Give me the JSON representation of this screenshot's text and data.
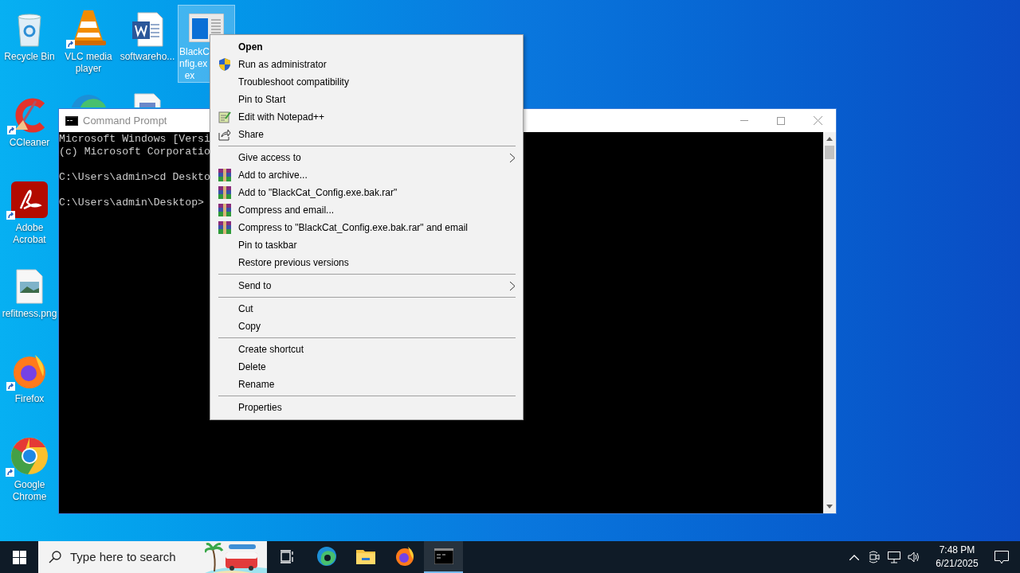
{
  "desktop_icon_columns": [
    [
      {
        "kind": "recycle-bin",
        "label": "Recycle Bin",
        "shortcut": false,
        "selected": false
      },
      {
        "kind": "ccleaner",
        "label": "CCleaner",
        "shortcut": true,
        "selected": false
      },
      {
        "kind": "pdf-app",
        "label": "Adobe\nAcrobat",
        "shortcut": true,
        "selected": false
      },
      {
        "kind": "image-file",
        "label": "refitness.png",
        "shortcut": false,
        "selected": false
      },
      {
        "kind": "firefox",
        "label": "Firefox",
        "shortcut": true,
        "selected": false
      },
      {
        "kind": "chrome",
        "label": "Google\nChrome",
        "shortcut": true,
        "selected": false
      }
    ],
    [
      {
        "kind": "vlc",
        "label": "VLC media\nplayer",
        "shortcut": true,
        "selected": false
      },
      {
        "kind": "edge",
        "shortcut": false,
        "selected": false
      }
    ],
    [
      {
        "kind": "word-doc",
        "label": "softwareho...",
        "shortcut": false,
        "selected": false
      },
      {
        "kind": "doc-file",
        "shortcut": false,
        "selected": false
      }
    ],
    [
      {
        "kind": "exe-window",
        "label": "BlackC\nnfig.ex\n  ex",
        "shortcut": false,
        "selected": true
      }
    ]
  ],
  "console_window": {
    "title": "Command Prompt",
    "paragraphs": [
      [
        "Microsoft Windows [Versi",
        "(c) Microsoft Corporatio"
      ],
      [
        "C:\\Users\\admin>cd Deskto"
      ],
      [
        "C:\\Users\\admin\\Desktop>"
      ]
    ]
  },
  "context_menu": [
    {
      "kind": "command",
      "label": "Open",
      "default": true,
      "submenu": false
    },
    {
      "kind": "elevated",
      "label": "Run as administrator",
      "default": false,
      "submenu": false
    },
    {
      "kind": "command",
      "label": "Troubleshoot compatibility",
      "default": false,
      "submenu": false
    },
    {
      "kind": "command",
      "label": "Pin to Start",
      "default": false,
      "submenu": false
    },
    {
      "kind": "notepad",
      "label": "Edit with Notepad++",
      "default": false,
      "submenu": false
    },
    {
      "kind": "share",
      "label": "Share",
      "default": false,
      "submenu": false
    },
    {
      "kind": "separator"
    },
    {
      "kind": "command",
      "label": "Give access to",
      "default": false,
      "submenu": true
    },
    {
      "kind": "archive",
      "label": "Add to archive...",
      "default": false,
      "submenu": false
    },
    {
      "kind": "archive",
      "label": "Add to \"BlackCat_Config.exe.bak.rar\"",
      "default": false,
      "submenu": false
    },
    {
      "kind": "archive",
      "label": "Compress and email...",
      "default": false,
      "submenu": false
    },
    {
      "kind": "archive",
      "label": "Compress to \"BlackCat_Config.exe.bak.rar\" and email",
      "default": false,
      "submenu": false
    },
    {
      "kind": "command",
      "label": "Pin to taskbar",
      "default": false,
      "submenu": false
    },
    {
      "kind": "command",
      "label": "Restore previous versions",
      "default": false,
      "submenu": false
    },
    {
      "kind": "separator"
    },
    {
      "kind": "command",
      "label": "Send to",
      "default": false,
      "submenu": true
    },
    {
      "kind": "separator"
    },
    {
      "kind": "command",
      "label": "Cut",
      "default": false,
      "submenu": false
    },
    {
      "kind": "command",
      "label": "Copy",
      "default": false,
      "submenu": false
    },
    {
      "kind": "separator"
    },
    {
      "kind": "command",
      "label": "Create shortcut",
      "default": false,
      "submenu": false
    },
    {
      "kind": "command",
      "label": "Delete",
      "default": false,
      "submenu": false
    },
    {
      "kind": "command",
      "label": "Rename",
      "default": false,
      "submenu": false
    },
    {
      "kind": "separator"
    },
    {
      "kind": "command",
      "label": "Properties",
      "default": false,
      "submenu": false
    }
  ],
  "taskbar": {
    "search": {
      "placeholder": "Type here to search"
    },
    "apps": [
      {
        "kind": "task-view",
        "active": false
      },
      {
        "kind": "edge",
        "active": false
      },
      {
        "kind": "explorer",
        "active": false
      },
      {
        "kind": "firefox",
        "active": false
      },
      {
        "kind": "terminal",
        "active": true
      }
    ],
    "clock": {
      "time": "7:48 PM",
      "date": "6/21/2025"
    }
  }
}
